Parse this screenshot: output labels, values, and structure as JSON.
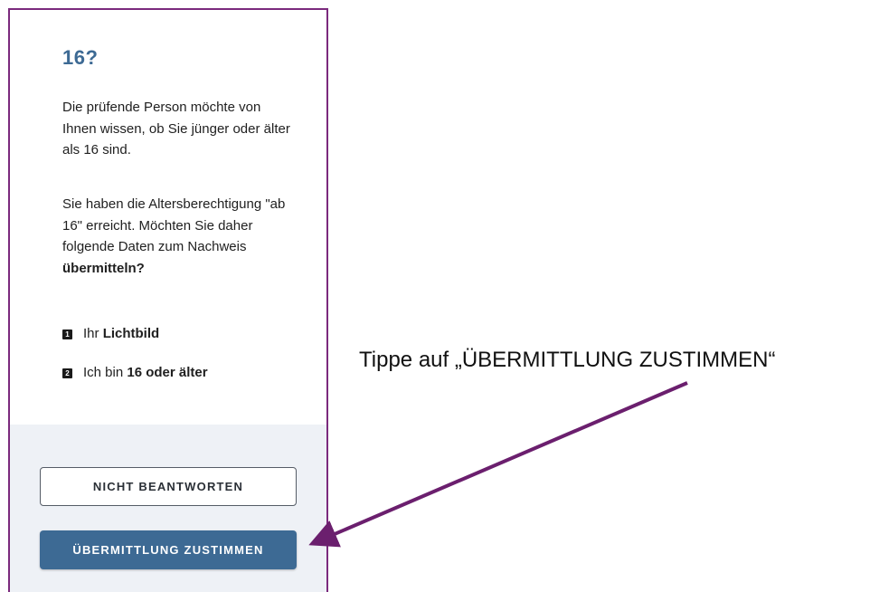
{
  "screen": {
    "title": "16?",
    "paragraph1": "Die prüfende Person möchte von Ihnen wissen, ob Sie jünger oder älter als 16 sind.",
    "paragraph2_prefix": "Sie haben die Altersberechtigung \"ab 16\" erreicht. Möchten Sie daher folgende Daten zum Nachweis ",
    "paragraph2_bold": "übermitteln?",
    "list": [
      {
        "number": "1",
        "prefix": "Ihr ",
        "bold": "Lichtbild"
      },
      {
        "number": "2",
        "prefix": "Ich bin ",
        "bold": "16 oder älter"
      }
    ]
  },
  "buttons": {
    "decline_label": "NICHT BEANTWORTEN",
    "accept_label": "ÜBERMITTLUNG ZUSTIMMEN"
  },
  "annotation": {
    "text": "Tippe auf „ÜBERMITTLUNG ZUSTIMMEN“",
    "arrow_color": "#6b1f6e"
  },
  "colors": {
    "frame_border": "#7b2a7d",
    "accent": "#3d6a94",
    "bottom_background": "#eef1f6"
  }
}
